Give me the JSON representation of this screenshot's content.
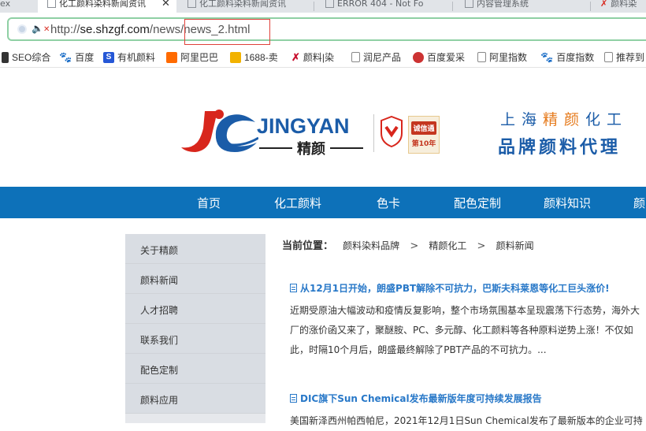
{
  "browser": {
    "tabs": [
      {
        "label": "ex",
        "active": false
      },
      {
        "label": "化工颜料染料新闻资讯",
        "active": true
      },
      {
        "label": "化工颜料染料新闻资讯",
        "active": false
      },
      {
        "label": "ERROR 404 - Not Fo",
        "active": false
      },
      {
        "label": "内容管理系统",
        "active": false
      },
      {
        "label": "颜料染",
        "active": false
      }
    ],
    "url": {
      "scheme": "http://",
      "host": "se.shzgf.com",
      "path_dir": "/news",
      "path_file": "/news_2.html"
    },
    "bookmarks": [
      {
        "label": "SEO综合",
        "icon": "seo-icon"
      },
      {
        "label": "百度",
        "icon": "baidu-paw-icon"
      },
      {
        "label": "有机颜料",
        "icon": "s-logo-icon"
      },
      {
        "label": "阿里巴巴",
        "icon": "alibaba-icon"
      },
      {
        "label": "1688-卖",
        "icon": "1688-icon"
      },
      {
        "label": "颜料|染",
        "icon": "jingyan-icon"
      },
      {
        "label": "润尼产品",
        "icon": "page-icon"
      },
      {
        "label": "百度爱采",
        "icon": "aicai-icon"
      },
      {
        "label": "阿里指数",
        "icon": "page-icon"
      },
      {
        "label": "百度指数",
        "icon": "baidu-paw-icon"
      },
      {
        "label": "推荐到",
        "icon": "page-icon"
      }
    ]
  },
  "header": {
    "logo_text": "JINGYAN",
    "logo_cn": "精颜",
    "badge_top": "诚信通",
    "badge_bottom": "第10年",
    "tagline_pre": "上海",
    "tagline_highlight": "精颜",
    "tagline_post": "化工",
    "tagline_2": "品牌颜料代理"
  },
  "nav": {
    "items": [
      "首页",
      "化工颜料",
      "色卡",
      "配色定制",
      "颜料知识",
      "颜"
    ]
  },
  "sidebar": {
    "items": [
      "关于精颜",
      "颜料新闻",
      "人才招聘",
      "联系我们",
      "配色定制",
      "颜料应用"
    ]
  },
  "breadcrumb": {
    "label": "当前位置：",
    "items": [
      "颜料染料品牌",
      "精颜化工",
      "颜料新闻"
    ],
    "separator": ">"
  },
  "articles": [
    {
      "title": "从12月1日开始，朗盛PBT解除不可抗力，巴斯夫科莱恩等化工巨头涨价!",
      "excerpt": "近期受原油大幅波动和疫情反复影响，整个市场氛围基本呈现震荡下行态势，海外大厂的涨价函又来了，聚醚胺、PC、多元醇、化工颜料等各种原料逆势上涨！不仅如此，时隔10个月后，朗盛最终解除了PBT产品的不可抗力。..."
    },
    {
      "title": "DIC旗下Sun Chemical发布最新版年度可持续发展报告",
      "excerpt": "美国新泽西州帕西帕尼，2021年12月1日Sun Chemical发布了最新版本的企业可持"
    }
  ],
  "colors": {
    "nav_bg": "#0d71b9",
    "link_blue": "#2878c8",
    "brand_blue": "#1b5ca8",
    "brand_red": "#d8261c",
    "highlight_orange": "#e67b1d"
  }
}
